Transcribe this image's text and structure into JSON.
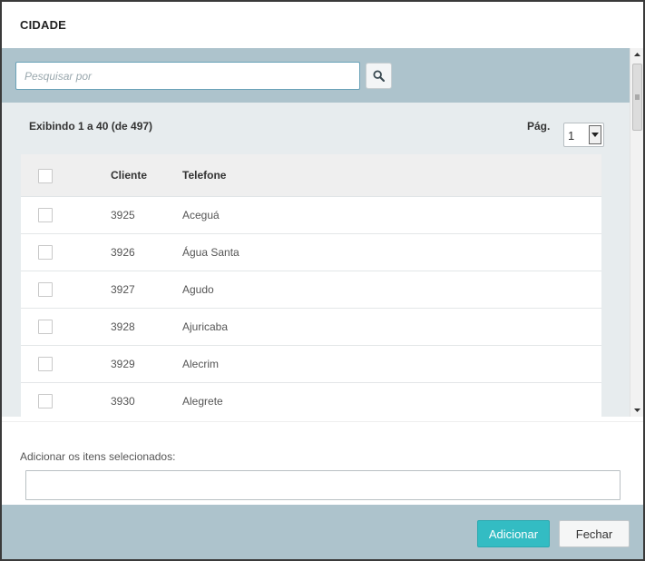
{
  "dialog": {
    "title": "CIDADE"
  },
  "search": {
    "placeholder": "Pesquisar por",
    "value": "",
    "icon": "search-icon"
  },
  "listing": {
    "showing_text": "Exibindo 1 a 40 (de 497)",
    "page_label": "Pág.",
    "page_value": "1"
  },
  "table": {
    "columns": [
      "Cliente",
      "Telefone"
    ],
    "rows": [
      {
        "cliente": "3925",
        "telefone": "Aceguá"
      },
      {
        "cliente": "3926",
        "telefone": "Água Santa"
      },
      {
        "cliente": "3927",
        "telefone": "Agudo"
      },
      {
        "cliente": "3928",
        "telefone": "Ajuricaba"
      },
      {
        "cliente": "3929",
        "telefone": "Alecrim"
      },
      {
        "cliente": "3930",
        "telefone": "Alegrete"
      }
    ]
  },
  "selection": {
    "label": "Adicionar os itens selecionados:",
    "value": ""
  },
  "footer": {
    "add_label": "Adicionar",
    "close_label": "Fechar"
  },
  "colors": {
    "accent": "#33bcc3",
    "band": "#adc3cc"
  }
}
